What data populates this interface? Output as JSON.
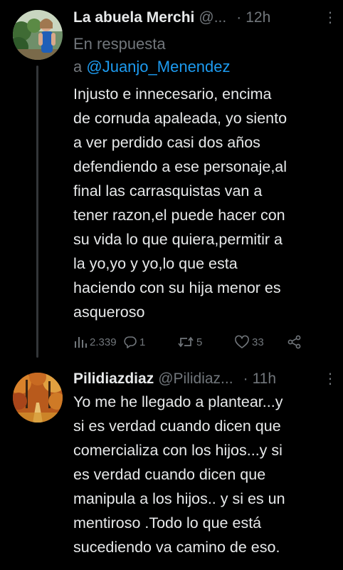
{
  "tweets": [
    {
      "display_name": "La abuela Merchi",
      "handle": "@...",
      "separator": "·",
      "time": "12h",
      "more": "⋮",
      "reply_prefix": "En respuesta",
      "reply_a": "a",
      "reply_to": "@Juanjo_Menendez",
      "text_lines": [
        "Injusto e innecesario, encima",
        "de cornuda apaleada, yo siento",
        "a ver perdido casi dos años",
        "defendiendo a ese personaje,al",
        "final las carrasquistas van a",
        "tener razon,el puede hacer con",
        "su vida lo que quiera,permitir a",
        "la yo,yo y yo,lo que esta",
        "haciendo con su hija menor es",
        "asqueroso"
      ],
      "stats": {
        "views": "2.339",
        "replies": "1",
        "retweets": "5",
        "likes": "33"
      },
      "icons": [
        "views-icon",
        "reply-icon",
        "retweet-icon",
        "like-icon",
        "share-icon"
      ]
    },
    {
      "display_name": "Pilidiazdiaz",
      "handle": "@Pilidiaz...",
      "separator": "·",
      "time": "11h",
      "more": "⋮",
      "text_lines": [
        "Yo me he llegado a plantear...y",
        "si es verdad cuando dicen que",
        "comercializa con los hijos...y si",
        "es verdad cuando dicen que",
        "manipula a los hijos.. y si es un",
        "mentiroso .Todo lo que está",
        "sucediendo va camino de eso."
      ]
    }
  ],
  "colors": {
    "background": "#000000",
    "text": "#e7e9ea",
    "secondary": "#71767b",
    "link": "#1d9bf0",
    "thread_line": "#333639"
  }
}
